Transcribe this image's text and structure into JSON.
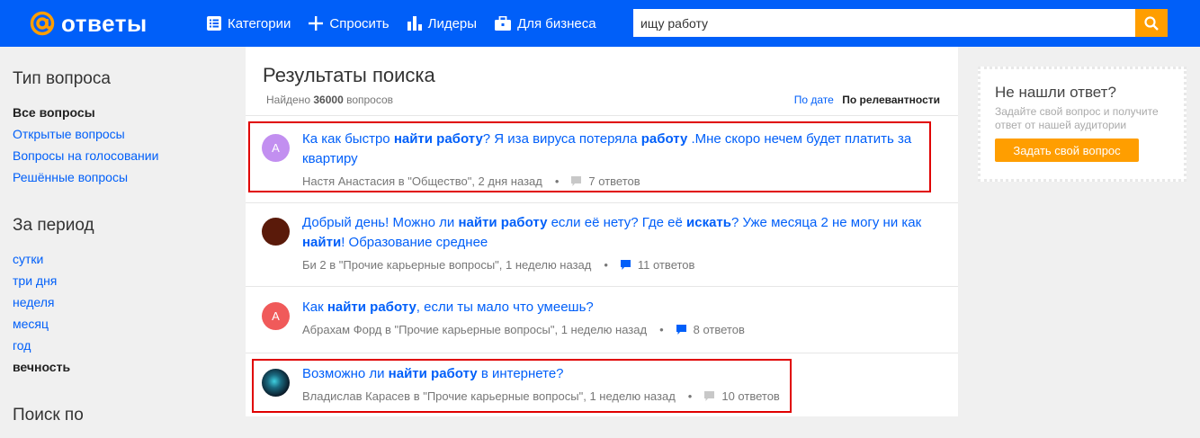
{
  "header": {
    "logo_text": "ответы",
    "nav": [
      {
        "label": "Категории",
        "icon": "list-icon"
      },
      {
        "label": "Спросить",
        "icon": "plus-icon"
      },
      {
        "label": "Лидеры",
        "icon": "bar-chart-icon"
      },
      {
        "label": "Для бизнеса",
        "icon": "briefcase-icon"
      }
    ],
    "search_value": "ищу работу"
  },
  "sidebar": {
    "type_title": "Тип вопроса",
    "type_items": [
      "Все вопросы",
      "Открытые вопросы",
      "Вопросы на голосовании",
      "Решённые вопросы"
    ],
    "period_title": "За период",
    "period_items": [
      "сутки",
      "три дня",
      "неделя",
      "месяц",
      "год",
      "вечность"
    ],
    "search_by_title": "Поиск по"
  },
  "main": {
    "title": "Результаты поиска",
    "found_prefix": "Найдено",
    "found_count": "36000",
    "found_suffix": "вопросов",
    "sort_date": "По дате",
    "sort_relevance": "По релевантности"
  },
  "questions": [
    {
      "avatar_letter": "А",
      "avatar_color": "#c28ff0",
      "title_parts": [
        "Ка как быстро ",
        "найти работу",
        "? Я иза вируса потеряла ",
        "работу",
        " .Мне скоро нечем будет платить за квартиру"
      ],
      "author": "Настя Анастасия",
      "category": "в \"Общество\"",
      "time": "2 дня назад",
      "answers": "7 ответов",
      "highlighted": true
    },
    {
      "avatar_letter": "",
      "avatar_color": "#5a1a0a",
      "title_parts": [
        "Добрый день! Можно ли ",
        "найти работу",
        " если её нету? Где её ",
        "искать",
        "? Уже месяца 2 не могу ни как ",
        "найти",
        "! Образование среднее"
      ],
      "author": "Би 2",
      "category": "в \"Прочие карьерные вопросы\"",
      "time": "1 неделю назад",
      "answers": "11 ответов",
      "highlighted": false
    },
    {
      "avatar_letter": "А",
      "avatar_color": "#f05a5a",
      "title_parts": [
        "Как ",
        "найти работу",
        ", если ты мало что умеешь?"
      ],
      "author": "Абрахам Форд",
      "category": "в \"Прочие карьерные вопросы\"",
      "time": "1 неделю назад",
      "answers": "8 ответов",
      "highlighted": false
    },
    {
      "avatar_letter": "",
      "avatar_color": "#0a2a3a",
      "title_parts": [
        "Возможно ли ",
        "найти работу",
        " в интернете?"
      ],
      "author": "Владислав Карасев",
      "category": "в \"Прочие карьерные вопросы\"",
      "time": "1 неделю назад",
      "answers": "10 ответов",
      "highlighted": true
    }
  ],
  "right": {
    "title": "Не нашли ответ?",
    "text": "Задайте свой вопрос и получите ответ от нашей аудитории",
    "button": "Задать свой вопрос"
  },
  "colors": {
    "brand_blue": "#005ff9",
    "accent_orange": "#ff9e00",
    "highlight_red": "#e00000"
  }
}
